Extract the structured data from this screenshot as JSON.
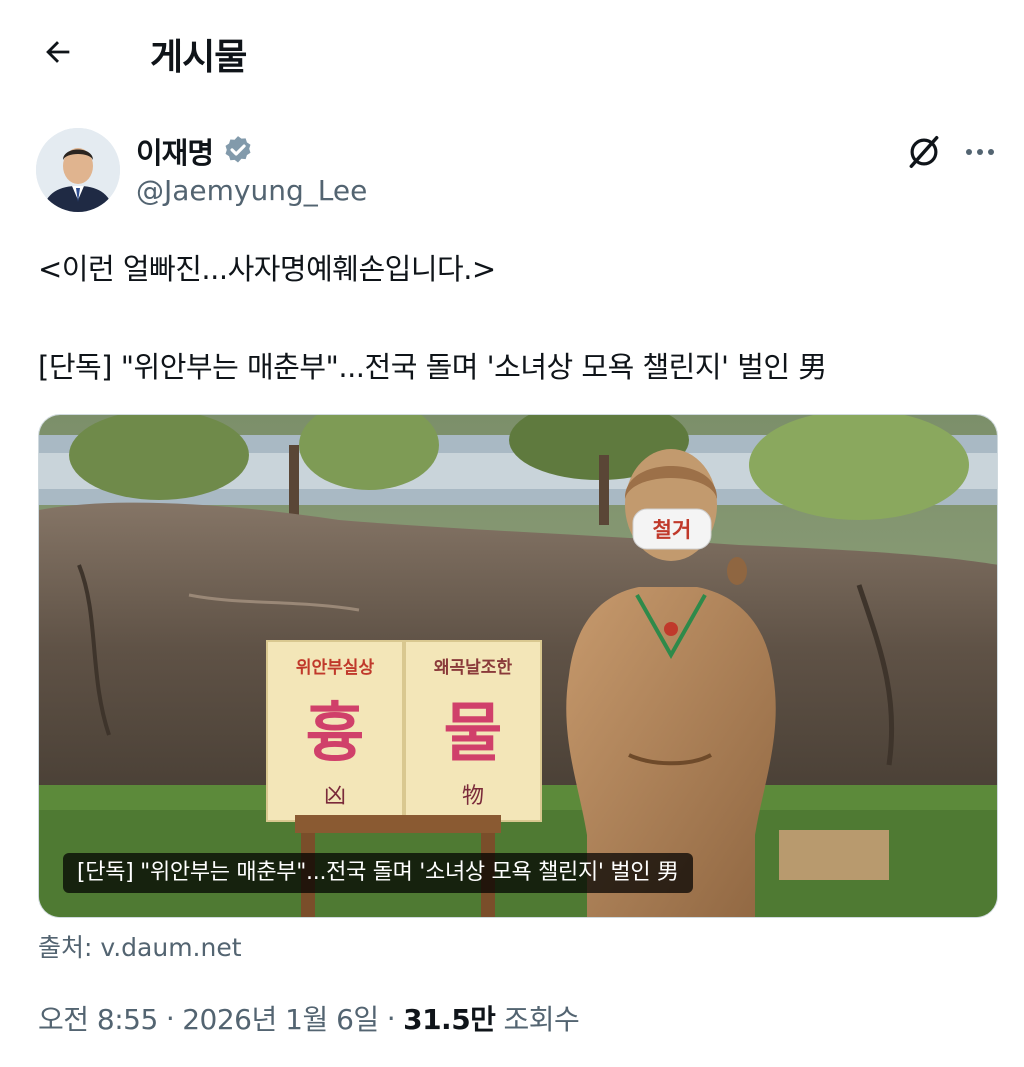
{
  "header": {
    "back_icon": "arrow-left-icon",
    "title": "게시물"
  },
  "author": {
    "display_name": "이재명",
    "handle": "@Jaemyung_Lee",
    "verified_icon": "verified-badge-icon",
    "verified_color": "#829aab"
  },
  "actions": {
    "grok_icon": "grok-icon",
    "more_icon": "more-horizontal-icon"
  },
  "tweet": {
    "line1": "<이런 얼빠진...사자명예훼손입니다.>",
    "line2": "[단독] \"위안부는 매춘부\"...전국 돌며 '소녀상 모욕 챌린지' 벌인 男"
  },
  "card": {
    "caption": "[단독] \"위안부는 매춘부\"...전국 돌며 '소녀상 모욕 챌린지' 벌인 男",
    "sign_left_top": "위안부실상",
    "sign_left_big": "흉",
    "sign_left_hanja": "凶",
    "sign_right_top": "왜곡날조한",
    "sign_right_big": "물",
    "sign_right_hanja": "物",
    "mask_text": "철거",
    "source_label": "출처: v.daum.net"
  },
  "meta": {
    "time": "오전 8:55",
    "separator": "·",
    "date": "2026년 1월 6일",
    "views_count": "31.5만",
    "views_label": "조회수"
  }
}
